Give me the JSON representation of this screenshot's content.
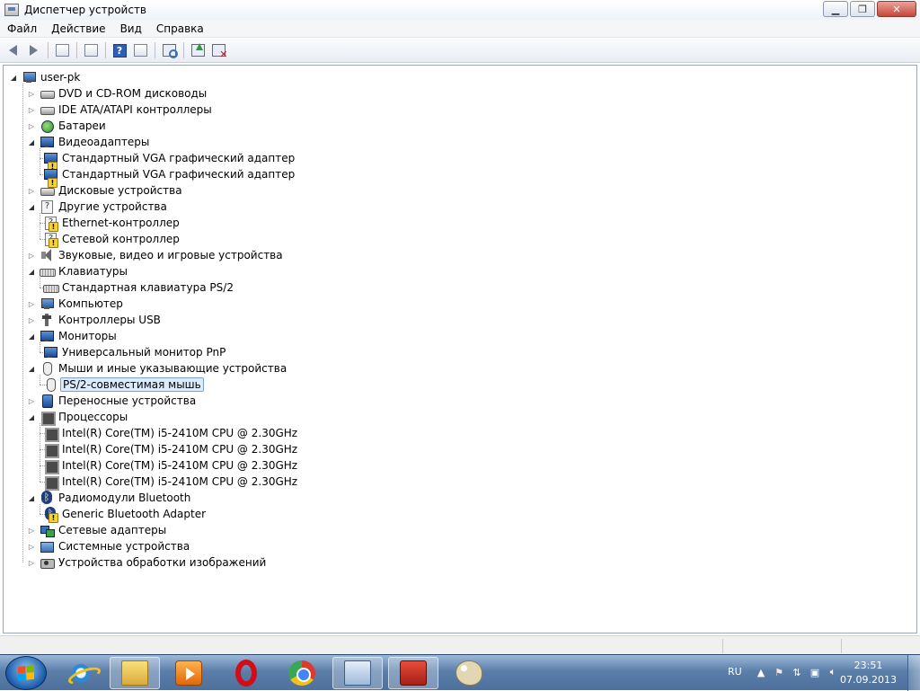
{
  "window": {
    "title": "Диспетчер устройств",
    "controls": [
      "minimize",
      "maximize",
      "close"
    ]
  },
  "menu": [
    "Файл",
    "Действие",
    "Вид",
    "Справка"
  ],
  "toolbar": {
    "icons": [
      "back-icon",
      "forward-icon",
      "show-hide-tree-icon",
      "properties-icon",
      "help-icon",
      "action-pane-icon",
      "scan-hardware-icon",
      "update-driver-icon",
      "uninstall-icon"
    ]
  },
  "tree": {
    "root": "user-pk",
    "items": [
      {
        "label": "DVD и CD-ROM дисководы",
        "icon": "disk"
      },
      {
        "label": "IDE ATA/ATAPI контроллеры",
        "icon": "disk"
      },
      {
        "label": "Батареи",
        "icon": "battery"
      },
      {
        "label": "Видеоадаптеры",
        "icon": "monitor",
        "expanded": true
      },
      {
        "label": "Стандартный VGA графический адаптер",
        "icon": "monitor-warn",
        "child": true
      },
      {
        "label": "Стандартный VGA графический адаптер",
        "icon": "monitor-warn",
        "child": true
      },
      {
        "label": "Дисковые устройства",
        "icon": "disk"
      },
      {
        "label": "Другие устройства",
        "icon": "unknown",
        "expanded": true
      },
      {
        "label": "Ethernet-контроллер",
        "icon": "unknown-warn",
        "child": true
      },
      {
        "label": "Сетевой контроллер",
        "icon": "unknown-warn",
        "child": true
      },
      {
        "label": "Звуковые, видео и игровые устройства",
        "icon": "sound"
      },
      {
        "label": "Клавиатуры",
        "icon": "keyboard",
        "expanded": true
      },
      {
        "label": "Стандартная клавиатура PS/2",
        "icon": "keyboard",
        "child": true
      },
      {
        "label": "Компьютер",
        "icon": "computer"
      },
      {
        "label": "Контроллеры USB",
        "icon": "usb"
      },
      {
        "label": "Мониторы",
        "icon": "monitor",
        "expanded": true
      },
      {
        "label": "Универсальный монитор PnP",
        "icon": "monitor",
        "child": true
      },
      {
        "label": "Мыши и иные указывающие устройства",
        "icon": "mouse",
        "expanded": true
      },
      {
        "label": "PS/2-совместимая мышь",
        "icon": "mouse",
        "child": true,
        "selected": true
      },
      {
        "label": "Переносные устройства",
        "icon": "portable"
      },
      {
        "label": "Процессоры",
        "icon": "cpu",
        "expanded": true
      },
      {
        "label": "Intel(R) Core(TM) i5-2410M CPU @ 2.30GHz",
        "icon": "cpu",
        "child": true
      },
      {
        "label": "Intel(R) Core(TM) i5-2410M CPU @ 2.30GHz",
        "icon": "cpu",
        "child": true
      },
      {
        "label": "Intel(R) Core(TM) i5-2410M CPU @ 2.30GHz",
        "icon": "cpu",
        "child": true
      },
      {
        "label": "Intel(R) Core(TM) i5-2410M CPU @ 2.30GHz",
        "icon": "cpu",
        "child": true
      },
      {
        "label": "Радиомодули Bluetooth",
        "icon": "bluetooth",
        "expanded": true
      },
      {
        "label": "Generic Bluetooth Adapter",
        "icon": "bluetooth-warn",
        "child": true
      },
      {
        "label": "Сетевые адаптеры",
        "icon": "network"
      },
      {
        "label": "Системные устройства",
        "icon": "system"
      },
      {
        "label": "Устройства обработки изображений",
        "icon": "imaging"
      }
    ]
  },
  "taskbar": {
    "apps": [
      "internet-explorer-icon",
      "explorer-folder-icon",
      "media-player-icon",
      "opera-icon",
      "chrome-icon",
      "device-manager-icon",
      "toolbox-icon",
      "paint-icon"
    ],
    "active_app": "toolbox-icon",
    "language": "RU",
    "time": "23:51",
    "date": "07.09.2013"
  },
  "colors": {
    "selection_bg": "#dcebfc",
    "selection_border": "#7da2ce",
    "warning": "#f6d23a",
    "taskbar": "#5c7fa9"
  }
}
